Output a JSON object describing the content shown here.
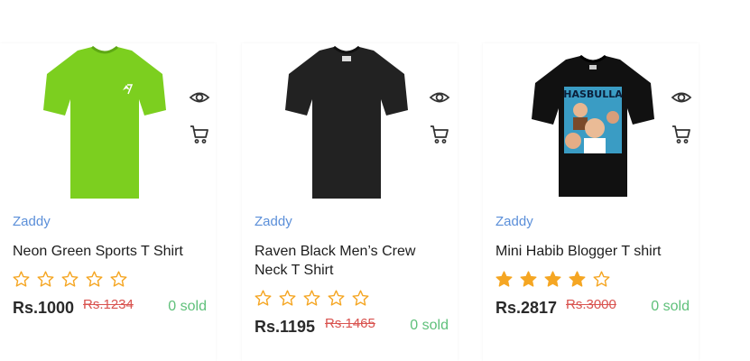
{
  "products": [
    {
      "brand": "Zaddy",
      "title": "Neon Green Sports T Shirt",
      "rating": 0,
      "price": "Rs.1000",
      "old_price": "Rs.1234",
      "sold": "0 sold",
      "shirt_color": "#7ccf1f",
      "icons": [
        "eye-icon",
        "cart-icon"
      ]
    },
    {
      "brand": "Zaddy",
      "title": "Raven Black Men’s Crew Neck T Shirt",
      "rating": 0,
      "price": "Rs.1195",
      "old_price": "Rs.1465",
      "sold": "0 sold",
      "shirt_color": "#222222",
      "icons": [
        "eye-icon",
        "cart-icon"
      ]
    },
    {
      "brand": "Zaddy",
      "title": "Mini Habib Blogger T shirt",
      "rating": 4,
      "price": "Rs.2817",
      "old_price": "Rs.3000",
      "sold": "0 sold",
      "shirt_color": "#111111",
      "print_text": "HASBULLA",
      "icons": [
        "eye-icon",
        "cart-icon"
      ]
    }
  ],
  "colors": {
    "brand": "#5b8fd9",
    "old_price": "#d9534f",
    "sold": "#5fc07a",
    "star_fill": "#f5a623"
  }
}
